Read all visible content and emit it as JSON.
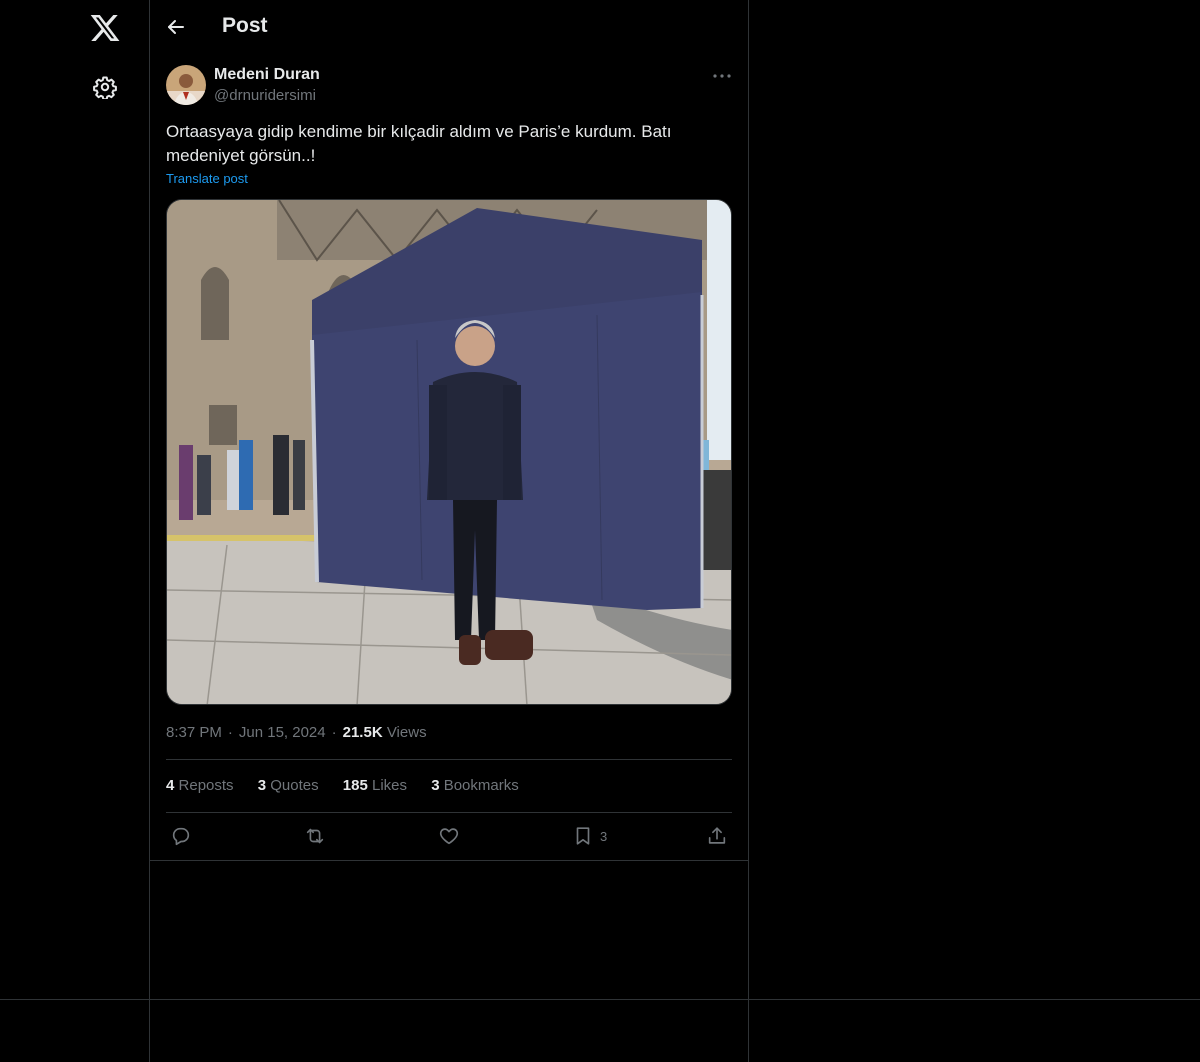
{
  "nav": {
    "logo_icon": "x-logo-icon",
    "settings_icon": "gear-icon"
  },
  "header": {
    "title": "Post",
    "back_icon": "back-arrow-icon"
  },
  "post": {
    "author_name": "Medeni Duran",
    "author_handle": "@drnuridersimi",
    "text": "Ortaasyaya gidip kendime bir kılçadir aldım ve Paris’e kurdum. Batı medeniyet görsün..!",
    "translate_label": "Translate post",
    "time": "8:37 PM",
    "date": "Jun 15, 2024",
    "views_count": "21.5K",
    "views_label": "Views"
  },
  "stats": {
    "reposts_count": "4",
    "reposts_label": "Reposts",
    "quotes_count": "3",
    "quotes_label": "Quotes",
    "likes_count": "185",
    "likes_label": "Likes",
    "bookmarks_count": "3",
    "bookmarks_label": "Bookmarks"
  },
  "actions": {
    "reply_icon": "reply-icon",
    "repost_icon": "repost-icon",
    "like_icon": "heart-icon",
    "bookmark_icon": "bookmark-icon",
    "bookmark_count": "3",
    "share_icon": "share-icon"
  },
  "colors": {
    "background": "#000000",
    "border": "#2f3336",
    "text": "#e7e9ea",
    "muted": "#71767b",
    "link": "#1d9bf0"
  }
}
